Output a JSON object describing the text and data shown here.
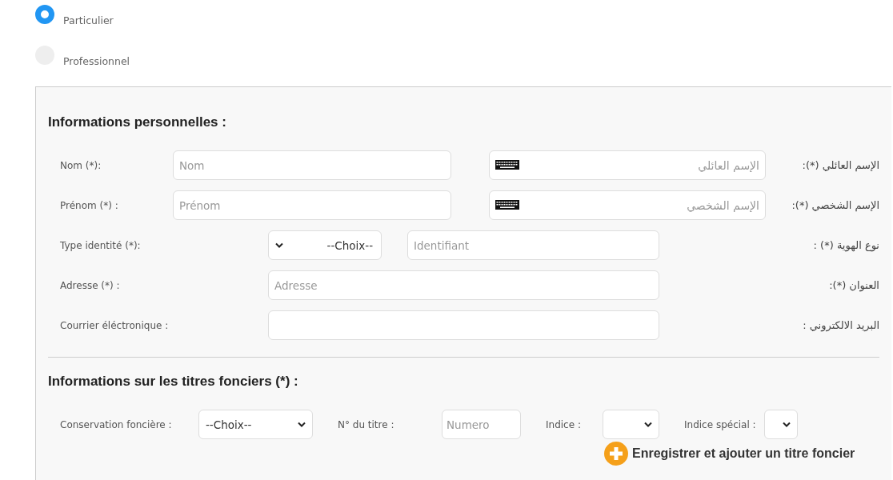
{
  "account_type": [
    {
      "label": "Particulier",
      "selected": true
    },
    {
      "label": "Professionnel",
      "selected": false
    }
  ],
  "personal_info": {
    "heading": "Informations personnelles :",
    "fields": [
      {
        "kind": "bilingual",
        "label": "Nom (*):",
        "placeholder": "Nom",
        "placeholder_ar": "الإسم العائلي",
        "label_ar": "الإسم العائلي (*):"
      },
      {
        "kind": "bilingual",
        "label": "Prénom (*) :",
        "placeholder": "Prénom",
        "placeholder_ar": "الإسم الشخصي",
        "label_ar": "الإسم الشخصي (*):"
      },
      {
        "kind": "select_input",
        "label": "Type identité (*):",
        "select": "--Choix--",
        "placeholder": "Identifiant",
        "label_ar": "نوع الهوية (*) :"
      },
      {
        "kind": "input",
        "label": "Adresse (*) :",
        "placeholder": "Adresse",
        "label_ar": "العنوان (*):"
      },
      {
        "kind": "input",
        "label": "Courrier éléctronique :",
        "label_ar": "البريد الالكتروني :"
      }
    ]
  },
  "land_titles": {
    "heading": "Informations sur les titres fonciers (*) :",
    "conservation_label": "Conservation foncière :",
    "conservation_select": "--Choix--",
    "title_number_label": "N° du titre :",
    "title_number_placeholder": "Numero",
    "index_label": "Indice :",
    "special_index_label": "Indice spécial :",
    "add_button": "Enregistrer et ajouter un titre foncier"
  }
}
